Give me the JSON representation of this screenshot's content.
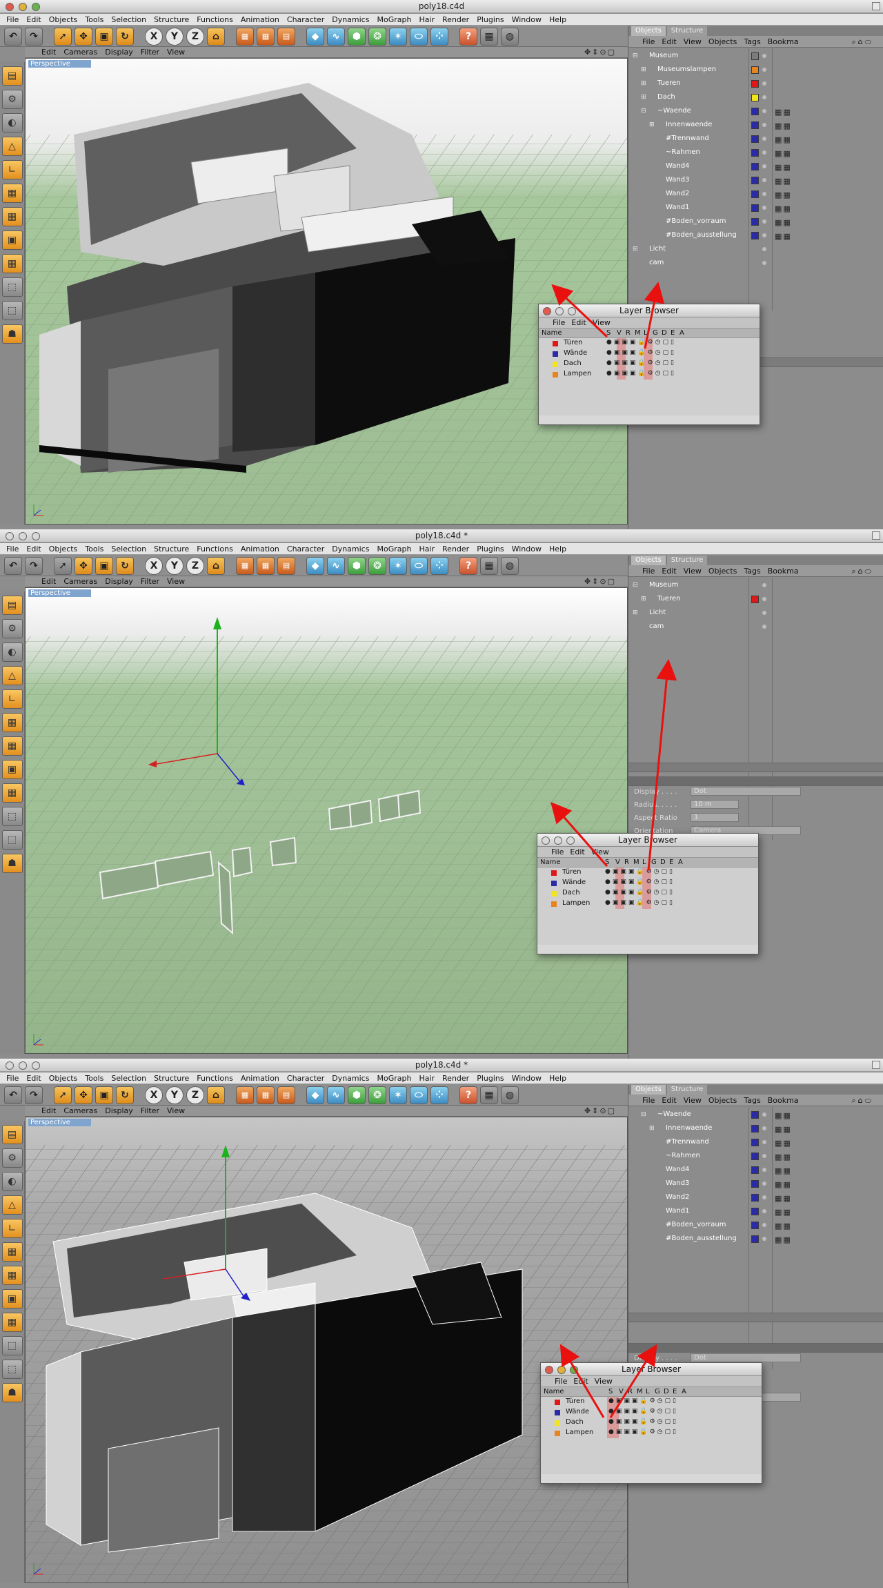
{
  "window": {
    "title1": "poly18.c4d",
    "title2": "poly18.c4d *",
    "title3": "poly18.c4d *"
  },
  "menubar": [
    "File",
    "Edit",
    "Objects",
    "Tools",
    "Selection",
    "Structure",
    "Functions",
    "Animation",
    "Character",
    "Dynamics",
    "MoGraph",
    "Hair",
    "Render",
    "Plugins",
    "Window",
    "Help"
  ],
  "viewport": {
    "menu": [
      "Edit",
      "Cameras",
      "Display",
      "Filter",
      "View"
    ],
    "label": "Perspective"
  },
  "toolbar": {
    "x": "X",
    "y": "Y",
    "z": "Z"
  },
  "objects_panel": {
    "tabs": [
      "Objects",
      "Structure"
    ],
    "menu": [
      "File",
      "Edit",
      "View",
      "Objects",
      "Tags",
      "Bookma"
    ]
  },
  "tree1": [
    {
      "name": "Museum",
      "indent": 0,
      "plus": "-",
      "color": "#7c7c7c"
    },
    {
      "name": "Museumslampen",
      "indent": 1,
      "plus": "+",
      "color": "#e8841e"
    },
    {
      "name": "Tueren",
      "indent": 1,
      "plus": "+",
      "color": "#e01717"
    },
    {
      "name": "Dach",
      "indent": 1,
      "plus": "+",
      "color": "#f2e51a"
    },
    {
      "name": "~Waende",
      "indent": 1,
      "plus": "-",
      "color": "#2b2ba8"
    },
    {
      "name": "Innenwaende",
      "indent": 2,
      "plus": "+",
      "color": "#2b2ba8"
    },
    {
      "name": "#Trennwand",
      "indent": 2,
      "plus": "",
      "color": "#2b2ba8"
    },
    {
      "name": "~Rahmen",
      "indent": 2,
      "plus": "",
      "color": "#2b2ba8"
    },
    {
      "name": "Wand4",
      "indent": 2,
      "plus": "",
      "color": "#2b2ba8"
    },
    {
      "name": "Wand3",
      "indent": 2,
      "plus": "",
      "color": "#2b2ba8"
    },
    {
      "name": "Wand2",
      "indent": 2,
      "plus": "",
      "color": "#2b2ba8"
    },
    {
      "name": "Wand1",
      "indent": 2,
      "plus": "",
      "color": "#2b2ba8"
    },
    {
      "name": "#Boden_vorraum",
      "indent": 2,
      "plus": "",
      "color": "#2b2ba8"
    },
    {
      "name": "#Boden_ausstellung",
      "indent": 2,
      "plus": "",
      "color": "#2b2ba8"
    },
    {
      "name": "Licht",
      "indent": 0,
      "plus": "+",
      "color": ""
    },
    {
      "name": "cam",
      "indent": 0,
      "plus": "",
      "color": ""
    }
  ],
  "tree2": [
    {
      "name": "Museum",
      "indent": 0,
      "plus": "-",
      "color": ""
    },
    {
      "name": "Tueren",
      "indent": 1,
      "plus": "+",
      "color": "#e01717"
    },
    {
      "name": "Licht",
      "indent": 0,
      "plus": "+",
      "color": ""
    },
    {
      "name": "cam",
      "indent": 0,
      "plus": "",
      "color": ""
    }
  ],
  "tree3": [
    {
      "name": "~Waende",
      "indent": 1,
      "plus": "-",
      "color": "#2b2ba8"
    },
    {
      "name": "Innenwaende",
      "indent": 2,
      "plus": "+",
      "color": "#2b2ba8"
    },
    {
      "name": "#Trennwand",
      "indent": 2,
      "plus": "",
      "color": "#2b2ba8"
    },
    {
      "name": "~Rahmen",
      "indent": 2,
      "plus": "",
      "color": "#2b2ba8"
    },
    {
      "name": "Wand4",
      "indent": 2,
      "plus": "",
      "color": "#2b2ba8"
    },
    {
      "name": "Wand3",
      "indent": 2,
      "plus": "",
      "color": "#2b2ba8"
    },
    {
      "name": "Wand2",
      "indent": 2,
      "plus": "",
      "color": "#2b2ba8"
    },
    {
      "name": "Wand1",
      "indent": 2,
      "plus": "",
      "color": "#2b2ba8"
    },
    {
      "name": "#Boden_vorraum",
      "indent": 2,
      "plus": "",
      "color": "#2b2ba8"
    },
    {
      "name": "#Boden_ausstellung",
      "indent": 2,
      "plus": "",
      "color": "#2b2ba8"
    }
  ],
  "layer_browser": {
    "title": "Layer Browser",
    "menu": [
      "File",
      "Edit",
      "View"
    ],
    "columns": [
      "Name",
      "S",
      "V",
      "R",
      "M",
      "L",
      "G",
      "D",
      "E",
      "A"
    ],
    "layers": [
      {
        "name": "Türen",
        "color": "#e01717"
      },
      {
        "name": "Wände",
        "color": "#2b2ba8"
      },
      {
        "name": "Dach",
        "color": "#f2e51a"
      },
      {
        "name": "Lampen",
        "color": "#e8841e"
      }
    ]
  },
  "attributes": {
    "display_label": "Display . . . .",
    "display_value": "Dot",
    "radius_label": "Radius. . . . .",
    "radius_value": "10 m",
    "aspect_label": "Aspect Ratio",
    "aspect_value": "1",
    "orientation_label": "Orientation",
    "orientation_value": "Camera"
  },
  "colors": {
    "arrow": "#e8110f",
    "grid": "#a6c69c",
    "highlight": "#e65a5a"
  }
}
